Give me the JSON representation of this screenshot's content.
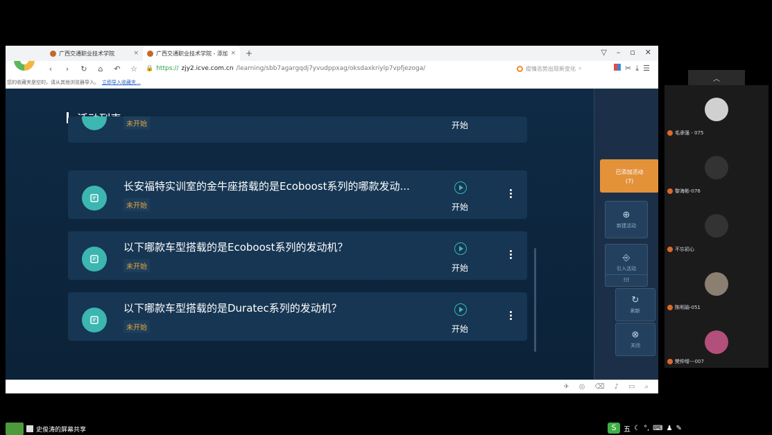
{
  "browser": {
    "tabs": [
      {
        "label": "广西交通职业技术学院"
      },
      {
        "label": "广西交通职业技术学院 - 添加"
      }
    ],
    "url": {
      "scheme": "https://",
      "host": "zjy2.icve.com.cn",
      "path": "/learning/sbb7agargqdj7yvudppxag/oksdaxkriylp7vpfjezoga/"
    },
    "search_placeholder": "疫情态势出现新变化",
    "bookmark_text": "您的收藏夹是空的，请从其他浏览器导入。",
    "bookmark_link": "立即导入收藏夹..."
  },
  "page": {
    "header_title": "活动列表",
    "cards": [
      {
        "title": "",
        "status": "未开始",
        "action": "开始"
      },
      {
        "title": "长安福特实训室的金牛座搭载的是Ecoboost系列的哪款发动...",
        "status": "未开始",
        "action": "开始"
      },
      {
        "title": "以下哪款车型搭载的是Ecoboost系列的发动机？",
        "status": "未开始",
        "action": "开始"
      },
      {
        "title": "以下哪款车型搭载的是Duratec系列的发动机？",
        "status": "未开始",
        "action": "开始"
      }
    ],
    "right_panel": {
      "added_label": "已添加活动",
      "added_count": "(7)",
      "new_label": "新建活动",
      "import_label": "引入活动",
      "refresh_label": "刷新",
      "close_label": "关闭"
    }
  },
  "participants": [
    {
      "name": "毛承强 - 075"
    },
    {
      "name": "黎海彬-076"
    },
    {
      "name": "不忘初心"
    },
    {
      "name": "陈明瑜-051"
    },
    {
      "name": "樊仲增---007"
    }
  ],
  "bottom": {
    "share_label": "史俊涛的屏幕共享",
    "ime_label": "五"
  }
}
